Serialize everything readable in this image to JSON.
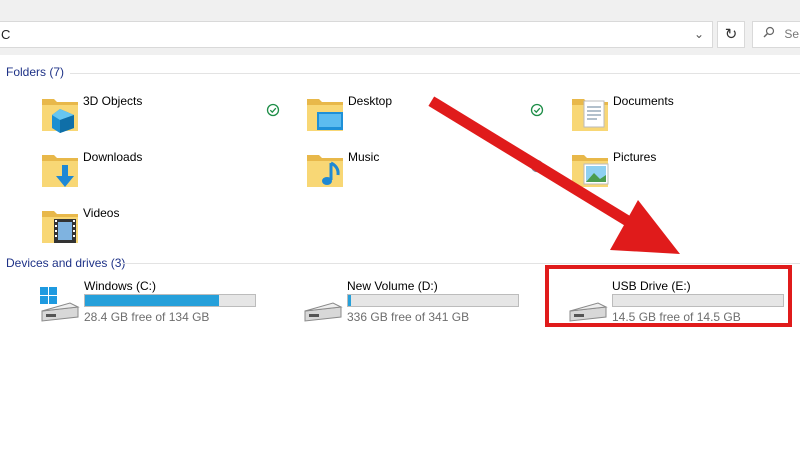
{
  "address_bar": {
    "text": "C",
    "dropdown_icon": "chevron-down-icon"
  },
  "refresh": {
    "icon": "refresh-icon",
    "glyph": "↻"
  },
  "search": {
    "icon": "search-icon",
    "placeholder": "Se"
  },
  "folders_section": {
    "title": "Folders (7)",
    "items": [
      {
        "label": "3D Objects",
        "icon": "3d-objects-folder-icon"
      },
      {
        "label": "Desktop",
        "icon": "desktop-folder-icon",
        "synced": true
      },
      {
        "label": "Documents",
        "icon": "documents-folder-icon",
        "synced": true
      },
      {
        "label": "Downloads",
        "icon": "downloads-folder-icon"
      },
      {
        "label": "Music",
        "icon": "music-folder-icon"
      },
      {
        "label": "Pictures",
        "icon": "pictures-folder-icon"
      },
      {
        "label": "Videos",
        "icon": "videos-folder-icon"
      }
    ]
  },
  "drives_section": {
    "title": "Devices and drives (3)",
    "drives": [
      {
        "name": "Windows (C:)",
        "free_text": "28.4 GB free of 134 GB",
        "used_fraction": 0.79,
        "icon": "windows-drive-icon"
      },
      {
        "name": "New Volume (D:)",
        "free_text": "336 GB free of 341 GB",
        "used_fraction": 0.015,
        "icon": "hard-drive-icon"
      },
      {
        "name": "USB Drive (E:)",
        "free_text": "14.5 GB free of 14.5 GB",
        "used_fraction": 0.0,
        "icon": "usb-drive-icon"
      }
    ]
  },
  "annotation": {
    "color": "#e01b1b",
    "target": "USB Drive (E:)"
  },
  "colors": {
    "accent": "#26a0da",
    "section_title": "#1e3287",
    "folder_yellow": "#f8d775"
  }
}
